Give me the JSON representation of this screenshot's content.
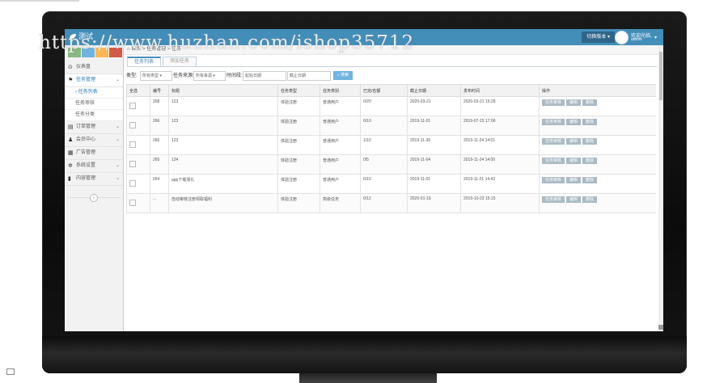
{
  "app": {
    "brand": "测试",
    "watermark": "https://www.huzhan.com/ishop35712"
  },
  "header": {
    "button_label": "切换版本",
    "user_name": "欢迎光临,",
    "user_role": "admin"
  },
  "shortcuts": [
    {
      "icon": "signal-icon",
      "color": "#87b87f"
    },
    {
      "icon": "pencil-icon",
      "color": "#6fb3e0"
    },
    {
      "icon": "users-icon",
      "color": "#ffb752"
    },
    {
      "icon": "cogs-icon",
      "color": "#d15b47"
    }
  ],
  "sidebar": {
    "items": [
      {
        "icon": "dashboard-icon",
        "glyph": "⊙",
        "label": "仪表盘",
        "chevron": ""
      },
      {
        "icon": "flag-icon",
        "glyph": "⚑",
        "label": "任务管理",
        "chevron": "⌄",
        "active": true
      },
      {
        "icon": "list-icon",
        "glyph": "▤",
        "label": "订单管理",
        "chevron": "⌄"
      },
      {
        "icon": "user-icon",
        "glyph": "♟",
        "label": "会员中心",
        "chevron": "⌄"
      },
      {
        "icon": "picture-icon",
        "glyph": "▦",
        "label": "广告管理",
        "chevron": ""
      },
      {
        "icon": "cog-icon",
        "glyph": "✲",
        "label": "系统设置",
        "chevron": "⌄"
      },
      {
        "icon": "book-icon",
        "glyph": "▮",
        "label": "内容管理",
        "chevron": "⌄"
      }
    ],
    "subitems": [
      {
        "label": "任务列表",
        "current": true
      },
      {
        "label": "任务审核"
      },
      {
        "label": "任务分类"
      }
    ]
  },
  "breadcrumb": {
    "home_icon": "home-icon",
    "text": "首页 > 任务管理 > 任务"
  },
  "tabs": [
    {
      "label": "任务列表",
      "active": true
    },
    {
      "label": "添加任务",
      "active": false
    }
  ],
  "filters": {
    "type_label": "类型:",
    "type_value": "所有类型",
    "source_label": "任务来源:",
    "source_value": "所有来源",
    "time_label": "时间段:",
    "start_placeholder": "起始日期",
    "end_placeholder": "截止日期",
    "search_button": "搜索"
  },
  "table": {
    "headers": [
      "全选",
      "编号",
      "标题",
      "任务类型",
      "任务类别",
      "已完/名额",
      "截止日期",
      "发布时间",
      "操作"
    ],
    "rows": [
      {
        "id": "268",
        "title": "123",
        "type": "体验注册",
        "category": "普通用户",
        "progress": "0/20",
        "deadline": "2020-03-21",
        "published": "2020-03-21 15:28"
      },
      {
        "id": "266",
        "title": "123",
        "type": "体验注册",
        "category": "普通用户",
        "progress": "0/10",
        "deadline": "2019-11-01",
        "published": "2019-07-15 17:06"
      },
      {
        "id": "266",
        "title": "123",
        "type": "体验注册",
        "category": "普通用户",
        "progress": "1/10",
        "deadline": "2019-11-30",
        "published": "2019-11-24 14:01"
      },
      {
        "id": "265",
        "title": "124",
        "type": "体验注册",
        "category": "普通用户",
        "progress": "0/5",
        "deadline": "2019-11-04",
        "published": "2019-11-24 14:00"
      },
      {
        "id": "264",
        "title": "app下载领礼",
        "type": "体验注册",
        "category": "普通用户",
        "progress": "0/10",
        "deadline": "2019-11-01",
        "published": "2019-11-21 14:43"
      },
      {
        "id": "...",
        "title": "自动审核注册领取福利",
        "type": "体验注册",
        "category": "高级任务",
        "progress": "0/12",
        "deadline": "2020-01-19",
        "published": "2019-10-23 15:15"
      }
    ],
    "actions": [
      "任务审核",
      "编辑",
      "删除"
    ]
  }
}
